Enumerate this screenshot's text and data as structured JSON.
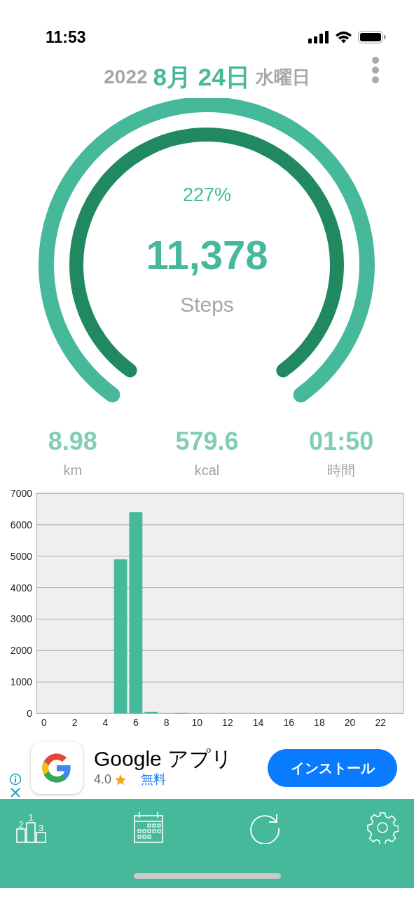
{
  "status_bar": {
    "time": "11:53"
  },
  "header": {
    "year": "2022",
    "date": "8月 24日",
    "weekday": "水曜日"
  },
  "gauge": {
    "rings": [
      {
        "color": "#45b99a"
      },
      {
        "color": "#21895f"
      }
    ],
    "percent": "227%",
    "steps": "11,378",
    "unit": "Steps"
  },
  "stats": [
    {
      "value": "8.98",
      "unit": "km"
    },
    {
      "value": "579.6",
      "unit": "kcal"
    },
    {
      "value": "01:50",
      "unit": "時間"
    }
  ],
  "hourly": {
    "chart_data": {
      "type": "bar",
      "x": [
        0,
        1,
        2,
        3,
        4,
        5,
        6,
        7,
        8,
        9,
        10,
        11,
        12,
        13,
        14,
        15,
        16,
        17,
        18,
        19,
        20,
        21,
        22,
        23
      ],
      "grid": true,
      "series": [
        {
          "color": "#45b99a",
          "values": [
            0,
            0,
            0,
            0,
            0,
            4900,
            6400,
            50,
            0,
            10,
            0,
            0,
            0,
            0,
            0,
            0,
            0,
            0,
            0,
            0,
            0,
            0,
            0,
            0
          ]
        }
      ],
      "xlim": [
        -0.5,
        23.5
      ],
      "ylim": [
        0,
        7000
      ],
      "yticks": [
        0,
        1000,
        2000,
        3000,
        4000,
        5000,
        6000,
        7000
      ],
      "xticks": [
        {
          "value": 0,
          "label": "0"
        },
        {
          "value": 2,
          "label": "2"
        },
        {
          "value": 4,
          "label": "4"
        },
        {
          "value": 6,
          "label": "6"
        },
        {
          "value": 8,
          "label": "8"
        },
        {
          "value": 10,
          "label": "10"
        },
        {
          "value": 12,
          "label": "12"
        },
        {
          "value": 14,
          "label": "14"
        },
        {
          "value": 16,
          "label": "16"
        },
        {
          "value": 18,
          "label": "18"
        },
        {
          "value": 20,
          "label": "20"
        },
        {
          "value": 22,
          "label": "22"
        }
      ]
    }
  },
  "ad": {
    "title": "Google アプリ",
    "rating": "4.0",
    "price": "無料",
    "button": "インストール"
  },
  "tab_bar": {
    "items": [
      {
        "kind": "ranking",
        "ranks": [
          "1",
          "2",
          "3"
        ]
      },
      {
        "kind": "calendar"
      },
      {
        "kind": "refresh"
      },
      {
        "kind": "settings"
      }
    ]
  }
}
